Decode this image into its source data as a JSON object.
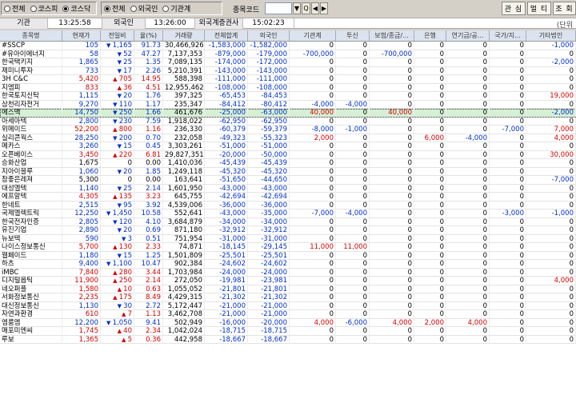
{
  "top": {
    "market_options": [
      {
        "label": "전체",
        "selected": false
      },
      {
        "label": "코스피",
        "selected": false
      },
      {
        "label": "코스닥",
        "selected": true
      }
    ],
    "scope_options": [
      {
        "label": "전체",
        "selected": true
      },
      {
        "label": "외국인",
        "selected": false
      },
      {
        "label": "기관계",
        "selected": false
      }
    ],
    "code_label": "종목코드",
    "code_value": "",
    "buttons": {
      "dropdown": "▼",
      "search": "Q",
      "prev": "◀",
      "next": "▶",
      "b1": "관 심",
      "b2": "멀 티",
      "b3": "조 회"
    }
  },
  "info": {
    "label1": "기관",
    "time1": "13:25:58",
    "label2": "외국인",
    "time2": "13:26:00",
    "label3": "외국계증권사",
    "time3": "15:02:23",
    "unit": "(단위"
  },
  "headers": [
    "종목명",
    "현재가",
    "전일비",
    "율(%)",
    "거래량",
    "전체합계",
    "외국인",
    "기관계",
    "투신",
    "보험/종금/...",
    "은행",
    "연기금/공...",
    "국가/지...",
    "기타법인"
  ],
  "rows": [
    {
      "name": "#SSCP",
      "price": "105",
      "dir": "dn",
      "chg": "1,165",
      "rate": "91.73",
      "vol": "30,466,926",
      "total": "-1,583,000",
      "foreign": "-1,582,000",
      "inst": "0",
      "trust": "0",
      "ins": "0",
      "bank": "0",
      "pen": "0",
      "nat": "0",
      "etc": "-1,000"
    },
    {
      "name": "#유아이에너지",
      "price": "58",
      "dir": "dn",
      "chg": "52",
      "rate": "47.27",
      "vol": "7,137,353",
      "total": "-879,000",
      "foreign": "-179,000",
      "inst": "-700,000",
      "trust": "0",
      "ins": "-700,000",
      "bank": "0",
      "pen": "0",
      "nat": "0",
      "etc": "0"
    },
    {
      "name": "한국택키지",
      "price": "1,865",
      "dir": "dn",
      "chg": "25",
      "rate": "1.35",
      "vol": "7,089,135",
      "total": "-174,000",
      "foreign": "-172,000",
      "inst": "0",
      "trust": "0",
      "ins": "0",
      "bank": "0",
      "pen": "0",
      "nat": "0",
      "etc": "-2,000"
    },
    {
      "name": "제미니투자",
      "price": "733",
      "dir": "dn",
      "chg": "17",
      "rate": "2.26",
      "vol": "5,210,391",
      "total": "-143,000",
      "foreign": "-143,000",
      "inst": "0",
      "trust": "0",
      "ins": "0",
      "bank": "0",
      "pen": "0",
      "nat": "0",
      "etc": "0"
    },
    {
      "name": "3H C&C",
      "price": "5,420",
      "dir": "up",
      "chg": "705",
      "rate": "14.95",
      "vol": "588,398",
      "total": "-111,000",
      "foreign": "-111,000",
      "inst": "0",
      "trust": "0",
      "ins": "0",
      "bank": "0",
      "pen": "0",
      "nat": "0",
      "etc": "0"
    },
    {
      "name": "지엠피",
      "price": "833",
      "dir": "up",
      "chg": "36",
      "rate": "4.51",
      "vol": "12,955,462",
      "total": "-108,000",
      "foreign": "-108,000",
      "inst": "0",
      "trust": "0",
      "ins": "0",
      "bank": "0",
      "pen": "0",
      "nat": "0",
      "etc": "0"
    },
    {
      "name": "한국토지신탁",
      "price": "1,115",
      "dir": "dn",
      "chg": "20",
      "rate": "1.76",
      "vol": "397,325",
      "total": "-65,453",
      "foreign": "-84,453",
      "inst": "0",
      "trust": "0",
      "ins": "0",
      "bank": "0",
      "pen": "0",
      "nat": "0",
      "etc": "19,000"
    },
    {
      "name": "삼천리자전거",
      "price": "9,270",
      "dir": "dn",
      "chg": "110",
      "rate": "1.17",
      "vol": "235,347",
      "total": "-84,412",
      "foreign": "-80,412",
      "inst": "-4,000",
      "trust": "-4,000",
      "ins": "0",
      "bank": "0",
      "pen": "0",
      "nat": "0",
      "etc": "0"
    },
    {
      "name": "에스맥",
      "price": "14,750",
      "dir": "dn",
      "chg": "250",
      "rate": "1.66",
      "vol": "461,676",
      "total": "-25,000",
      "foreign": "-63,000",
      "inst": "40,000",
      "trust": "0",
      "ins": "40,000",
      "bank": "0",
      "pen": "0",
      "nat": "0",
      "etc": "-2,000",
      "hl": true
    },
    {
      "name": "아세아텍",
      "price": "2,800",
      "dir": "dn",
      "chg": "230",
      "rate": "7.59",
      "vol": "1,918,022",
      "total": "-62,950",
      "foreign": "-62,950",
      "inst": "0",
      "trust": "0",
      "ins": "0",
      "bank": "0",
      "pen": "0",
      "nat": "0",
      "etc": "0"
    },
    {
      "name": "위메이드",
      "price": "52,200",
      "dir": "up",
      "chg": "800",
      "rate": "1.16",
      "vol": "236,330",
      "total": "-60,379",
      "foreign": "-59,379",
      "inst": "-8,000",
      "trust": "-1,000",
      "ins": "0",
      "bank": "0",
      "pen": "0",
      "nat": "-7,000",
      "etc": "7,000"
    },
    {
      "name": "실리콘웍스",
      "price": "28,250",
      "dir": "dn",
      "chg": "200",
      "rate": "0.70",
      "vol": "232,058",
      "total": "-49,323",
      "foreign": "-55,323",
      "inst": "2,000",
      "trust": "0",
      "ins": "0",
      "bank": "6,000",
      "pen": "-4,000",
      "nat": "0",
      "etc": "4,000"
    },
    {
      "name": "메카스",
      "price": "3,260",
      "dir": "dn",
      "chg": "15",
      "rate": "0.45",
      "vol": "3,303,261",
      "total": "-51,000",
      "foreign": "-51,000",
      "inst": "0",
      "trust": "0",
      "ins": "0",
      "bank": "0",
      "pen": "0",
      "nat": "0",
      "etc": "0"
    },
    {
      "name": "오픈베이스",
      "price": "3,450",
      "dir": "up",
      "chg": "220",
      "rate": "6.81",
      "vol": "29,827,351",
      "total": "-20,000",
      "foreign": "-50,000",
      "inst": "0",
      "trust": "0",
      "ins": "0",
      "bank": "0",
      "pen": "0",
      "nat": "0",
      "etc": "30,000"
    },
    {
      "name": "승화산업",
      "price": "1,675",
      "dir": "",
      "chg": "0",
      "rate": "0.00",
      "vol": "1,410,036",
      "total": "-45,439",
      "foreign": "-45,439",
      "inst": "0",
      "trust": "0",
      "ins": "0",
      "bank": "0",
      "pen": "0",
      "nat": "0",
      "etc": "0"
    },
    {
      "name": "지아이블루",
      "price": "1,060",
      "dir": "dn",
      "chg": "20",
      "rate": "1.85",
      "vol": "1,249,118",
      "total": "-45,320",
      "foreign": "-45,320",
      "inst": "0",
      "trust": "0",
      "ins": "0",
      "bank": "0",
      "pen": "0",
      "nat": "0",
      "etc": "0"
    },
    {
      "name": "참좋은레져",
      "price": "5,300",
      "dir": "",
      "chg": "0",
      "rate": "0.00",
      "vol": "163,641",
      "total": "-51,650",
      "foreign": "-44,650",
      "inst": "0",
      "trust": "0",
      "ins": "0",
      "bank": "0",
      "pen": "0",
      "nat": "0",
      "etc": "-7,000"
    },
    {
      "name": "대성엘텍",
      "price": "1,140",
      "dir": "dn",
      "chg": "25",
      "rate": "2.14",
      "vol": "1,601,950",
      "total": "-43,000",
      "foreign": "-43,000",
      "inst": "0",
      "trust": "0",
      "ins": "0",
      "bank": "0",
      "pen": "0",
      "nat": "0",
      "etc": "0"
    },
    {
      "name": "에프알텍",
      "price": "4,305",
      "dir": "up",
      "chg": "135",
      "rate": "3.23",
      "vol": "645,755",
      "total": "-42,694",
      "foreign": "-42,694",
      "inst": "0",
      "trust": "0",
      "ins": "0",
      "bank": "0",
      "pen": "0",
      "nat": "0",
      "etc": "0"
    },
    {
      "name": "한네트",
      "price": "2,515",
      "dir": "dn",
      "chg": "95",
      "rate": "3.92",
      "vol": "4,539,006",
      "total": "-36,000",
      "foreign": "-36,000",
      "inst": "0",
      "trust": "0",
      "ins": "0",
      "bank": "0",
      "pen": "0",
      "nat": "0",
      "etc": "0"
    },
    {
      "name": "국제엘렉트릭",
      "price": "12,250",
      "dir": "dn",
      "chg": "1,450",
      "rate": "10.58",
      "vol": "552,641",
      "total": "-43,000",
      "foreign": "-35,000",
      "inst": "-7,000",
      "trust": "-4,000",
      "ins": "0",
      "bank": "0",
      "pen": "0",
      "nat": "-3,000",
      "etc": "-1,000"
    },
    {
      "name": "한국전자인증",
      "price": "2,805",
      "dir": "dn",
      "chg": "120",
      "rate": "4.10",
      "vol": "3,684,879",
      "total": "-34,000",
      "foreign": "-34,000",
      "inst": "0",
      "trust": "0",
      "ins": "0",
      "bank": "0",
      "pen": "0",
      "nat": "0",
      "etc": "0"
    },
    {
      "name": "유진기업",
      "price": "2,890",
      "dir": "dn",
      "chg": "20",
      "rate": "0.69",
      "vol": "871,180",
      "total": "-32,912",
      "foreign": "-32,912",
      "inst": "0",
      "trust": "0",
      "ins": "0",
      "bank": "0",
      "pen": "0",
      "nat": "0",
      "etc": "0"
    },
    {
      "name": "뉴보텍",
      "price": "590",
      "dir": "dn",
      "chg": "3",
      "rate": "0.51",
      "vol": "751,954",
      "total": "-31,000",
      "foreign": "-31,000",
      "inst": "0",
      "trust": "0",
      "ins": "0",
      "bank": "0",
      "pen": "0",
      "nat": "0",
      "etc": "0"
    },
    {
      "name": "나이스정보통신",
      "price": "5,700",
      "dir": "up",
      "chg": "130",
      "rate": "2.33",
      "vol": "74,871",
      "total": "-18,145",
      "foreign": "-29,145",
      "inst": "11,000",
      "trust": "11,000",
      "ins": "0",
      "bank": "0",
      "pen": "0",
      "nat": "0",
      "etc": "0"
    },
    {
      "name": "웹페이드",
      "price": "1,180",
      "dir": "dn",
      "chg": "15",
      "rate": "1.25",
      "vol": "1,501,809",
      "total": "-25,501",
      "foreign": "-25,501",
      "inst": "0",
      "trust": "0",
      "ins": "0",
      "bank": "0",
      "pen": "0",
      "nat": "0",
      "etc": "0"
    },
    {
      "name": "하츠",
      "price": "9,400",
      "dir": "dn",
      "chg": "1,100",
      "rate": "10.47",
      "vol": "902,384",
      "total": "-24,602",
      "foreign": "-24,602",
      "inst": "0",
      "trust": "0",
      "ins": "0",
      "bank": "0",
      "pen": "0",
      "nat": "0",
      "etc": "0"
    },
    {
      "name": "iMBC",
      "price": "7,840",
      "dir": "up",
      "chg": "280",
      "rate": "3.44",
      "vol": "1,703,984",
      "total": "-24,000",
      "foreign": "-24,000",
      "inst": "0",
      "trust": "0",
      "ins": "0",
      "bank": "0",
      "pen": "0",
      "nat": "0",
      "etc": "0"
    },
    {
      "name": "디지털옵틱",
      "price": "11,900",
      "dir": "up",
      "chg": "250",
      "rate": "2.14",
      "vol": "272,050",
      "total": "-19,981",
      "foreign": "-23,981",
      "inst": "0",
      "trust": "0",
      "ins": "0",
      "bank": "0",
      "pen": "0",
      "nat": "0",
      "etc": "4,000"
    },
    {
      "name": "네오퍼플",
      "price": "1,580",
      "dir": "up",
      "chg": "10",
      "rate": "0.63",
      "vol": "1,055,052",
      "total": "-21,801",
      "foreign": "-21,801",
      "inst": "0",
      "trust": "0",
      "ins": "0",
      "bank": "0",
      "pen": "0",
      "nat": "0",
      "etc": "0"
    },
    {
      "name": "서화정보통신",
      "price": "2,235",
      "dir": "up",
      "chg": "175",
      "rate": "8.49",
      "vol": "4,429,315",
      "total": "-21,302",
      "foreign": "-21,302",
      "inst": "0",
      "trust": "0",
      "ins": "0",
      "bank": "0",
      "pen": "0",
      "nat": "0",
      "etc": "0"
    },
    {
      "name": "대신정보통신",
      "price": "1,130",
      "dir": "dn",
      "chg": "30",
      "rate": "2.72",
      "vol": "5,172,447",
      "total": "-21,000",
      "foreign": "-21,000",
      "inst": "0",
      "trust": "0",
      "ins": "0",
      "bank": "0",
      "pen": "0",
      "nat": "0",
      "etc": "0"
    },
    {
      "name": "자연과환경",
      "price": "610",
      "dir": "up",
      "chg": "7",
      "rate": "1.13",
      "vol": "3,462,708",
      "total": "-21,000",
      "foreign": "-21,000",
      "inst": "0",
      "trust": "0",
      "ins": "0",
      "bank": "0",
      "pen": "0",
      "nat": "0",
      "etc": "0"
    },
    {
      "name": "엠룸엠",
      "price": "12,200",
      "dir": "dn",
      "chg": "1,050",
      "rate": "9.41",
      "vol": "502,949",
      "total": "-16,000",
      "foreign": "-20,000",
      "inst": "4,000",
      "trust": "-6,000",
      "ins": "4,000",
      "bank": "2,000",
      "pen": "4,000",
      "nat": "0",
      "etc": "0"
    },
    {
      "name": "매포미엔씨",
      "price": "1,745",
      "dir": "up",
      "chg": "40",
      "rate": "2.34",
      "vol": "1,042,024",
      "total": "-18,715",
      "foreign": "-18,715",
      "inst": "0",
      "trust": "0",
      "ins": "0",
      "bank": "0",
      "pen": "0",
      "nat": "0",
      "etc": "0"
    },
    {
      "name": "루보",
      "price": "1,365",
      "dir": "up",
      "chg": "5",
      "rate": "0.36",
      "vol": "442,958",
      "total": "-18,667",
      "foreign": "-18,667",
      "inst": "0",
      "trust": "0",
      "ins": "0",
      "bank": "0",
      "pen": "0",
      "nat": "0",
      "etc": "0"
    }
  ]
}
